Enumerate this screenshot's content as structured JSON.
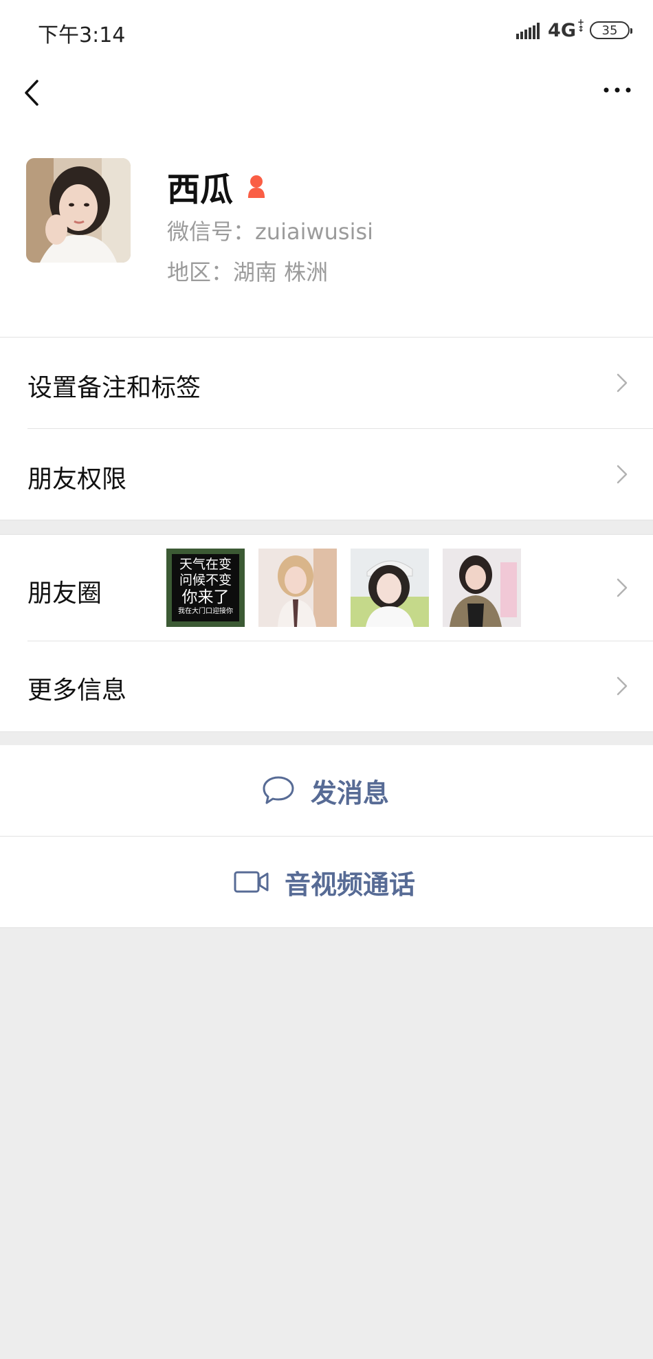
{
  "status_bar": {
    "time": "下午3:14",
    "network": "4G",
    "battery": "35"
  },
  "nav": {
    "back_icon": "chevron-left-icon",
    "more_icon": "more-dots-icon"
  },
  "profile": {
    "name": "西瓜",
    "gender_icon": "female-icon",
    "gender_color": "#fa5e45",
    "wechat_id": "微信号：zuiaiwusisi",
    "region": "地区：湖南  株洲"
  },
  "menu": {
    "remark_tags": "设置备注和标签",
    "permissions": "朋友权限",
    "moments": "朋友圈",
    "more_info": "更多信息"
  },
  "moments_thumbnail_text": {
    "line1": "天气在变",
    "line2": "问候不变",
    "line3": "你来了",
    "line4": "我在大门口迎接你"
  },
  "actions": {
    "send_message": "发消息",
    "video_call": "音视频通话"
  },
  "colors": {
    "link_blue": "#576b95",
    "background": "#ededed"
  }
}
